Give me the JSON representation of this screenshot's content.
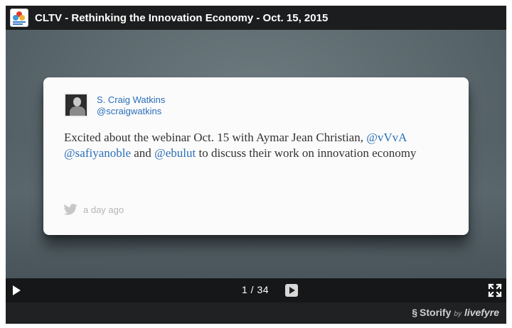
{
  "header": {
    "title": "CLTV - Rethinking the Innovation Economy - Oct. 15, 2015"
  },
  "card": {
    "author_name": "S. Craig Watkins",
    "author_handle": "@scraigwatkins",
    "tweet_part1": "Excited about the webinar Oct. 15 with Aymar Jean Christian, ",
    "mention1": "@vVvA",
    "space1": " ",
    "mention2": "@safiyanoble",
    "tweet_part2": " and ",
    "mention3": "@ebulut",
    "tweet_part3": " to discuss their work on innovation economy",
    "timestamp": "a day ago"
  },
  "controls": {
    "counter": "1 / 34"
  },
  "footer": {
    "brand_storify": "Storify",
    "brand_by": "by",
    "brand_livefyre": "livefyre"
  },
  "icons": {
    "logo": "cltv-logo-icon",
    "play": "play-icon",
    "next": "next-slide-icon",
    "fullscreen": "fullscreen-icon",
    "twitter": "twitter-bird-icon",
    "storify": "storify-s-icon"
  },
  "colors": {
    "link": "#2a6fb8",
    "titlebar": "#1c1d1e",
    "stage": "#5a676c"
  }
}
